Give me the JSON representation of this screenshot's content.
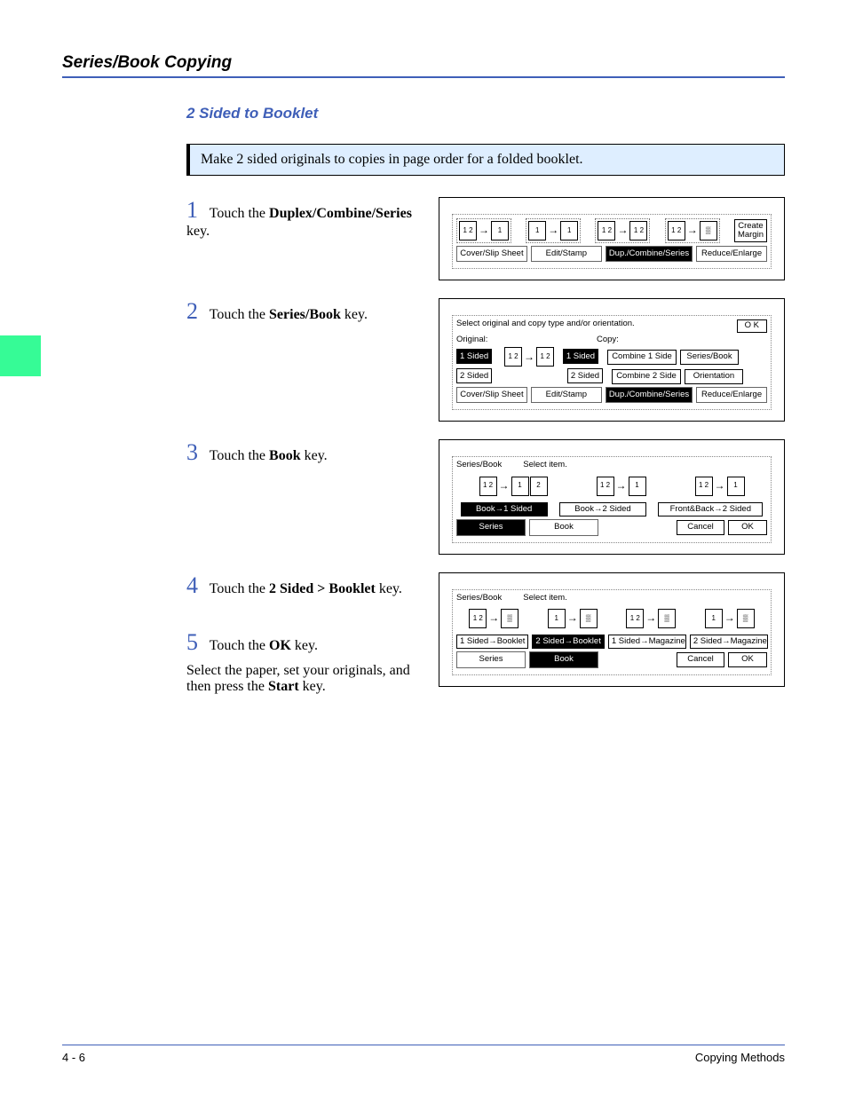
{
  "header": {
    "section": "Series/Book Copying"
  },
  "subheader": {
    "title": "2 Sided to Booklet"
  },
  "intro": {
    "text": "Make 2 sided originals to copies in page order for a folded booklet."
  },
  "steps": {
    "s1": {
      "num": "1",
      "pre": "Touch the ",
      "bold": "Duplex/Combine/Series",
      "post": " key."
    },
    "s2": {
      "num": "2",
      "pre": "Touch the ",
      "bold": "Series/Book",
      "post": " key."
    },
    "s3": {
      "num": "3",
      "pre": "Touch the ",
      "bold": "Book",
      "post": " key."
    },
    "s4": {
      "num": "4",
      "pre": "Touch the ",
      "bold": "2 Sided > Booklet",
      "post": " key."
    },
    "s5": {
      "num": "5",
      "pre": "Touch the ",
      "bold": "OK",
      "post": " key."
    }
  },
  "closing": {
    "pre": "Select the paper, set your originals, and then press the ",
    "bold": "Start",
    "post": " key."
  },
  "fig1": {
    "tabs": {
      "cover": "Cover/Slip Sheet",
      "edit": "Edit/Stamp",
      "dup": "Dup./Combine/Series",
      "reduce": "Reduce/Enlarge"
    },
    "create_margin": "Create\nMargin"
  },
  "fig2": {
    "instr": "Select original and copy type and/or orientation.",
    "original": "Original:",
    "copy": "Copy:",
    "ok": "O K",
    "btns": {
      "onesided": "1 Sided",
      "twosided": "2 Sided",
      "copy1": "1 Sided",
      "copy2": "2 Sided",
      "comb1": "Combine 1 Side",
      "comb2": "Combine 2 Side",
      "series": "Series/Book",
      "orient": "Orientation"
    },
    "tabs": {
      "cover": "Cover/Slip Sheet",
      "edit": "Edit/Stamp",
      "dup": "Dup./Combine/Series",
      "reduce": "Reduce/Enlarge"
    }
  },
  "fig3": {
    "title": "Series/Book",
    "select": "Select item.",
    "btns": {
      "b1": "Book→1 Sided",
      "b2": "Book→2 Sided",
      "fb2": "Front&Back→2 Sided"
    },
    "tabs": {
      "series": "Series",
      "book": "Book",
      "cancel": "Cancel",
      "ok": "OK"
    }
  },
  "fig4": {
    "title": "Series/Book",
    "select": "Select item.",
    "btns": {
      "b1": "1 Sided→Booklet",
      "b2": "2 Sided→Booklet",
      "m1": "1 Sided→Magazine",
      "m2": "2 Sided→Magazine"
    },
    "tabs": {
      "series": "Series",
      "book": "Book",
      "cancel": "Cancel",
      "ok": "OK"
    }
  },
  "footer": {
    "page": "4 - 6",
    "label": "Copying Methods"
  }
}
